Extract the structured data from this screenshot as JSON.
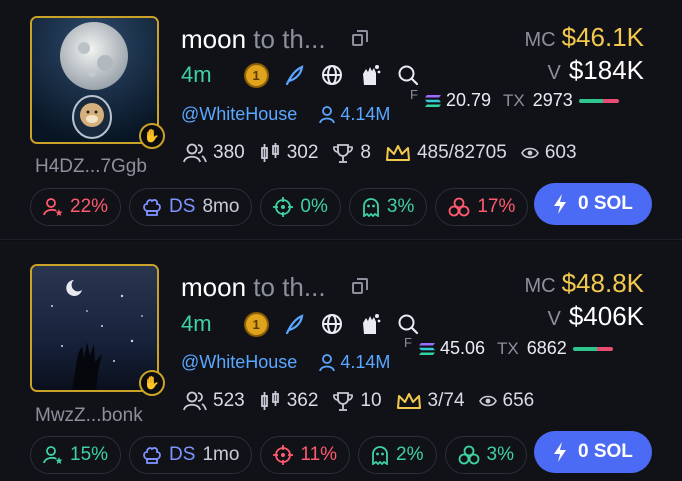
{
  "cards": [
    {
      "address": "H4DZ...7Ggb",
      "name": "moon",
      "symbol": "to th...",
      "age": "4m",
      "coin_badge": "1",
      "handle": "@WhiteHouse",
      "followers": "4.14M",
      "holders": "380",
      "trades": "302",
      "top10": "8",
      "crown": "485/82705",
      "views": "603",
      "mc_label": "MC",
      "mc_value": "$46.1K",
      "vol_label": "V",
      "vol_value": "$184K",
      "f_label": "F",
      "fee": "20.79",
      "tx_label": "TX",
      "tx_value": "2973",
      "chips": {
        "top_holders": "22%",
        "ds_label": "DS",
        "ds_age": "8mo",
        "target": "0%",
        "ghost": "3%",
        "bundle": "17%"
      },
      "buy_label": "0 SOL"
    },
    {
      "address": "MwzZ...bonk",
      "name": "moon",
      "symbol": "to th...",
      "age": "4m",
      "coin_badge": "1",
      "handle": "@WhiteHouse",
      "followers": "4.14M",
      "holders": "523",
      "trades": "362",
      "top10": "10",
      "crown": "3/74",
      "views": "656",
      "mc_label": "MC",
      "mc_value": "$48.8K",
      "vol_label": "V",
      "vol_value": "$406K",
      "f_label": "F",
      "fee": "45.06",
      "tx_label": "TX",
      "tx_value": "6862",
      "chips": {
        "top_holders": "15%",
        "ds_label": "DS",
        "ds_age": "1mo",
        "target": "11%",
        "ghost": "2%",
        "bundle": "3%"
      },
      "buy_label": "0 SOL"
    }
  ],
  "colors": {
    "accent_gold": "#f2c94c",
    "accent_green": "#3fd2a0",
    "accent_red": "#ff5a6e",
    "accent_blue": "#4b6bf5",
    "link_blue": "#5aa7ff"
  }
}
